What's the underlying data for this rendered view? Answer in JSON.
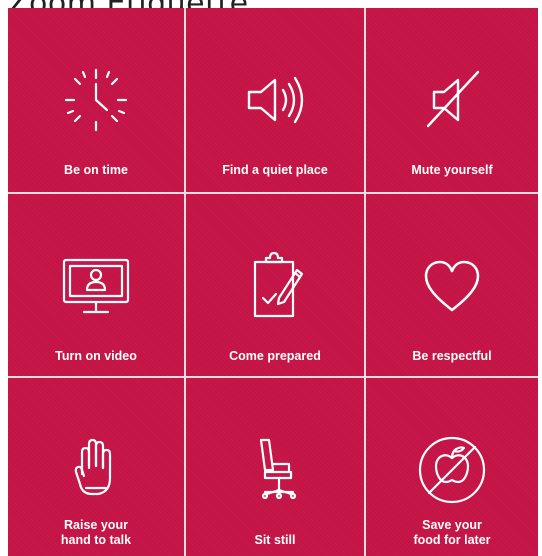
{
  "title": "Zoom Etiquette",
  "accent_color": "#c41446",
  "tiles": [
    {
      "label": "Be on time",
      "icon": "clock-icon"
    },
    {
      "label": "Find a quiet place",
      "icon": "speaker-icon"
    },
    {
      "label": "Mute yourself",
      "icon": "muted-speaker-icon"
    },
    {
      "label": "Turn on video",
      "icon": "monitor-person-icon"
    },
    {
      "label": "Come prepared",
      "icon": "clipboard-pen-icon"
    },
    {
      "label": "Be respectful",
      "icon": "heart-icon"
    },
    {
      "label": "Raise your\nhand to talk",
      "icon": "raised-hand-icon"
    },
    {
      "label": "Sit still",
      "icon": "office-chair-icon"
    },
    {
      "label": "Save your\nfood for later",
      "icon": "no-food-icon"
    }
  ]
}
